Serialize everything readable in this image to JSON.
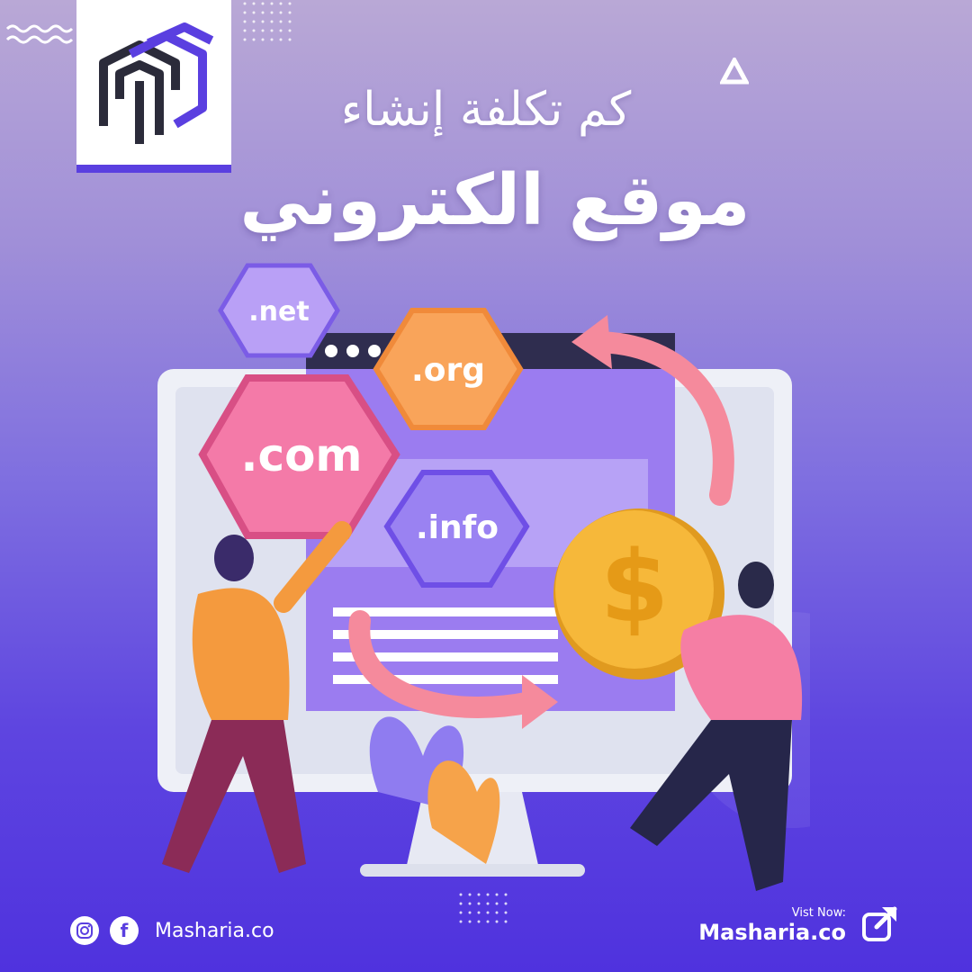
{
  "header": {
    "title_line1": "كم تكلفة إنشاء",
    "title_line2": "موقع الكتروني"
  },
  "domains": [
    ".net",
    ".org",
    ".com",
    ".info"
  ],
  "footer": {
    "brand_left": "Masharia.co",
    "visit_label": "Vist Now:",
    "brand_right": "Masharia.co"
  },
  "icons": {
    "logo": "masharia-logo-icon",
    "instagram": "instagram-icon",
    "facebook": "facebook-icon",
    "external_link": "external-link-icon",
    "dollar": "dollar-coin-icon"
  },
  "colors": {
    "accent": "#5a3fe0",
    "hex_pink": "#f36fa0",
    "hex_orange": "#f79a4a",
    "hex_purple": "#8b6cf0",
    "coin": "#f6b83a"
  }
}
